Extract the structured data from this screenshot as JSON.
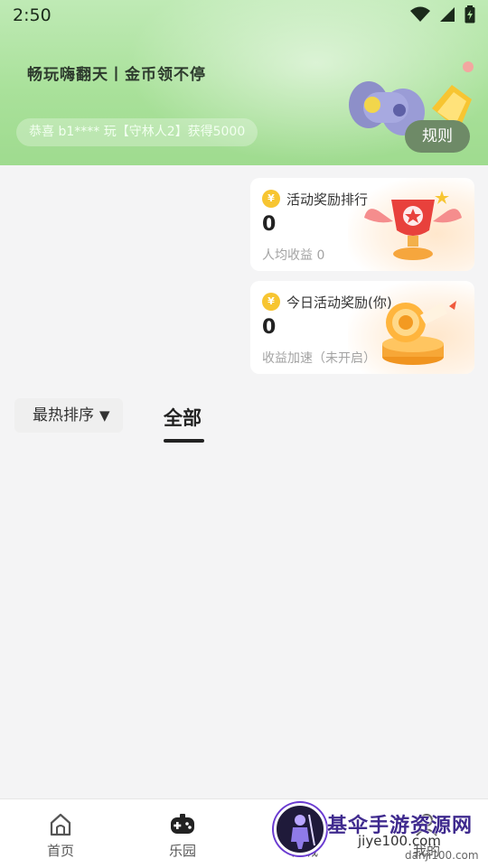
{
  "status_bar": {
    "time": "2:50"
  },
  "banner": {
    "slogan": "畅玩嗨翻天丨金币领不停",
    "ticker": "恭喜 b1**** 玩【守林人2】获得5000",
    "rules_label": "规则"
  },
  "cards": [
    {
      "title": "活动奖励排行",
      "value": "0",
      "sub": "人均收益 0",
      "coin_symbol": "¥",
      "art_icon": "trophy-icon"
    },
    {
      "title": "今日活动奖励(你)",
      "value": "0",
      "sub": "收益加速（未开启）",
      "coin_symbol": "¥",
      "art_icon": "target-coin-icon"
    }
  ],
  "filters": {
    "sort_label": "最热排序",
    "sort_arrow": "▼",
    "tabs": [
      {
        "label": "全部",
        "active": true
      }
    ]
  },
  "bottom_nav": [
    {
      "label": "首页",
      "icon": "home-icon"
    },
    {
      "label": "乐园",
      "icon": "gamepad-icon",
      "active": true
    },
    {
      "label": "商城",
      "icon": "shop-icon"
    },
    {
      "label": "我的",
      "icon": "profile-icon"
    }
  ],
  "watermark": {
    "title": "基伞手游资源网",
    "site": "jiye100.com",
    "url": "danji100.com"
  },
  "colors": {
    "banner": "#a9e19a",
    "rules_button": "#6e8a67",
    "coin": "#f7c531"
  }
}
